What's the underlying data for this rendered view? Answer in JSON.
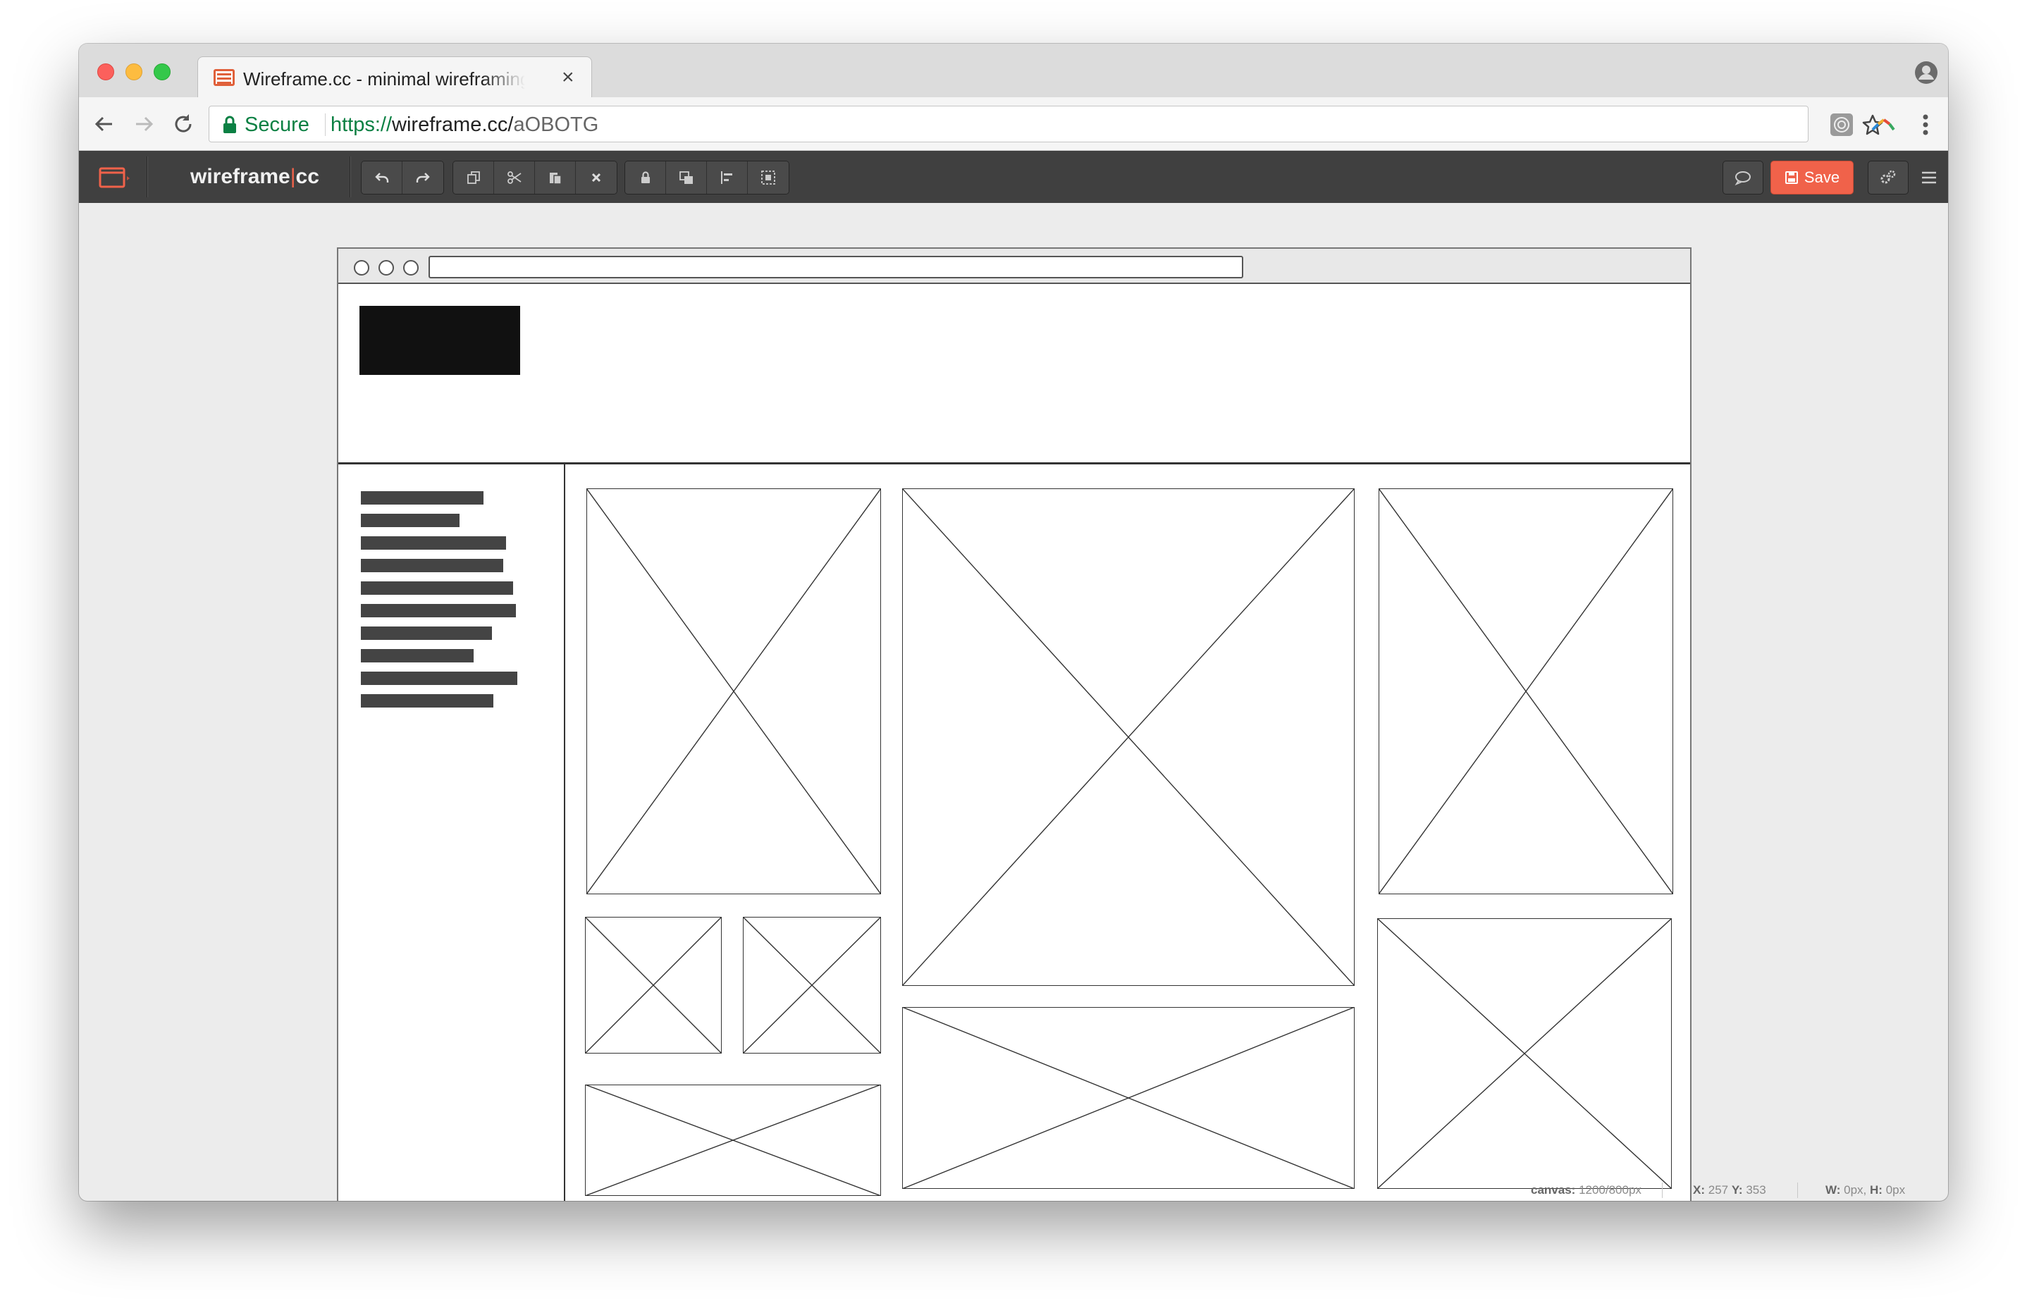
{
  "browser": {
    "tab_title": "Wireframe.cc - minimal wireframing tool",
    "tab_close": "×",
    "secure_label": "Secure",
    "url_protocol": "https://",
    "url_host": "wireframe.cc/",
    "url_path": "aOBOTG"
  },
  "app": {
    "brand_left": "wireframe",
    "brand_pipe": "|",
    "brand_right": "cc",
    "toolbar_groups": [
      [
        "undo-icon",
        "redo-icon"
      ],
      [
        "duplicate-icon",
        "cut-icon",
        "paste-icon",
        "delete-icon"
      ],
      [
        "lock-icon",
        "arrange-icon",
        "align-icon",
        "group-icon"
      ]
    ],
    "save_label": "Save",
    "accent_color": "#f0624a"
  },
  "status": {
    "canvas_label": "canvas:",
    "canvas_value": "1200/800px",
    "x_label": "X:",
    "x_value": "257",
    "y_label": "Y:",
    "y_value": "353",
    "w_label": "W:",
    "w_value": "0px,",
    "h_label": "H:",
    "h_value": "0px"
  },
  "wireframe": {
    "sidebar_text_lines": 10,
    "image_placeholders": 10
  }
}
